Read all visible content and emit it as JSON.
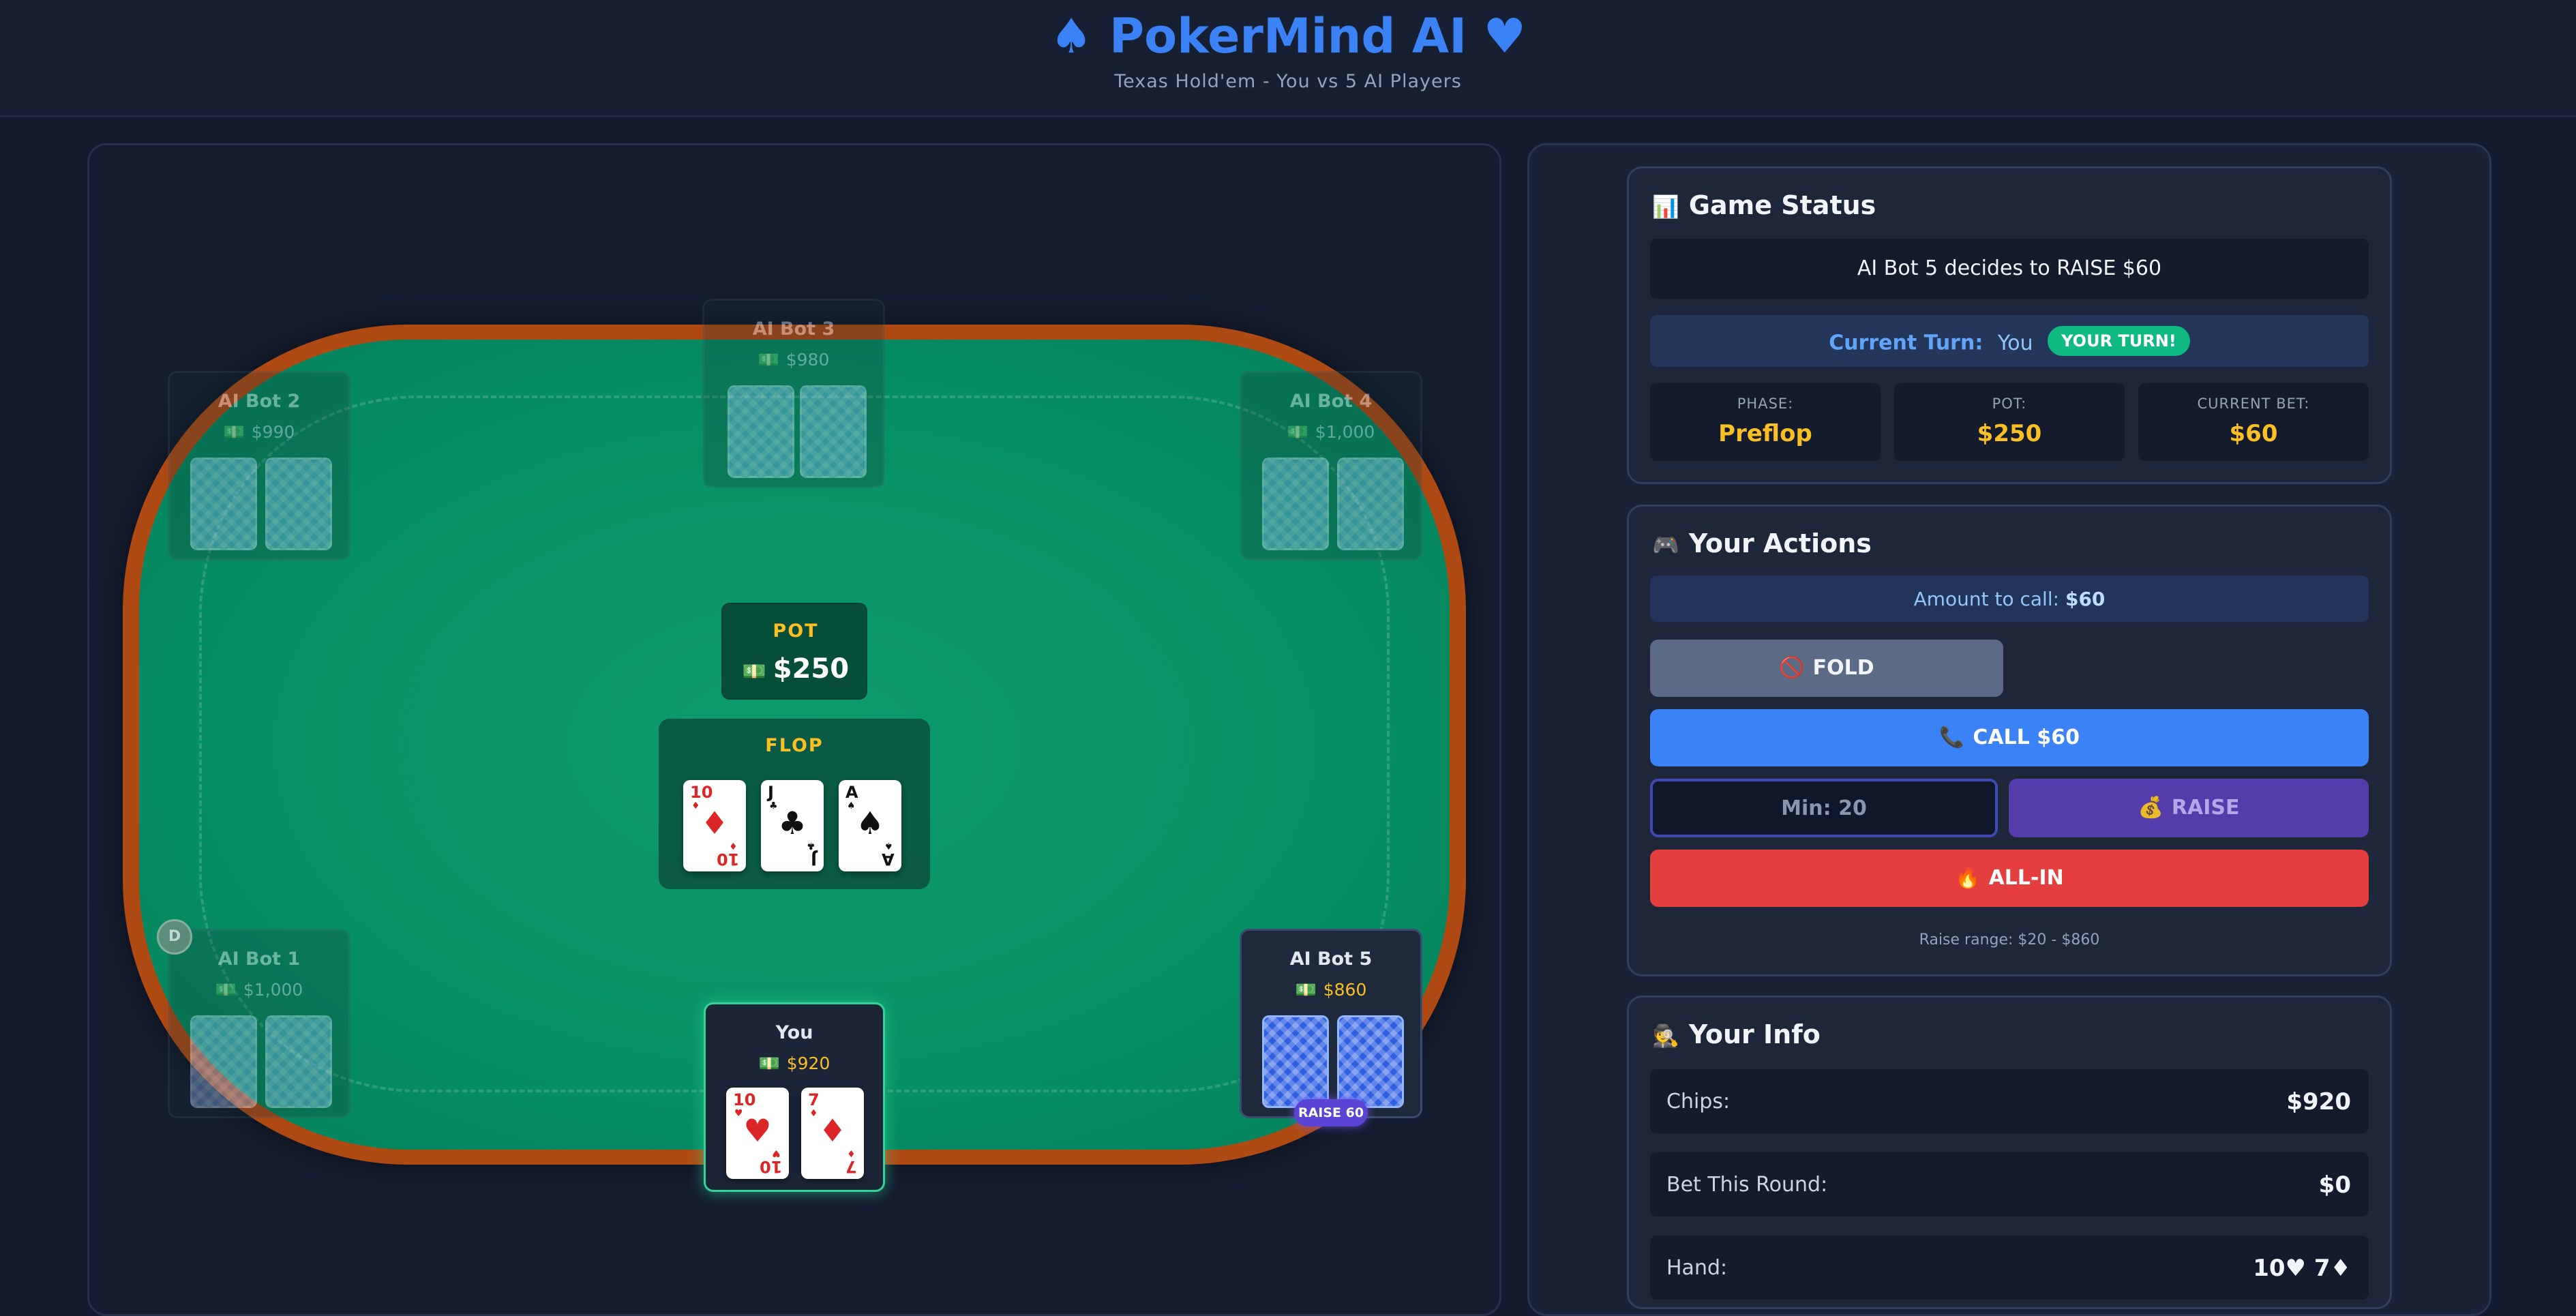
{
  "header": {
    "title": "PokerMind AI",
    "subtitle": "Texas Hold'em - You vs 5 AI Players",
    "left_icon": "spade-icon",
    "right_icon": "heart-icon"
  },
  "table": {
    "pot": {
      "label": "POT",
      "amount": "$250"
    },
    "board": {
      "label": "FLOP",
      "cards": [
        {
          "rank": "10",
          "suit": "♦",
          "color": "red"
        },
        {
          "rank": "J",
          "suit": "♣",
          "color": "black"
        },
        {
          "rank": "A",
          "suit": "♠",
          "color": "black"
        }
      ]
    },
    "dealer_button": "D",
    "seats": {
      "bot3": {
        "name": "AI Bot 3",
        "chips": "$980"
      },
      "bot2": {
        "name": "AI Bot 2",
        "chips": "$990"
      },
      "bot4": {
        "name": "AI Bot 4",
        "chips": "$1,000"
      },
      "bot1": {
        "name": "AI Bot 1",
        "chips": "$1,000"
      },
      "bot5": {
        "name": "AI Bot 5",
        "chips": "$860",
        "action": "RAISE 60"
      },
      "you": {
        "name": "You",
        "chips": "$920",
        "cards": [
          {
            "rank": "10",
            "suit": "♥",
            "color": "red"
          },
          {
            "rank": "7",
            "suit": "♦",
            "color": "red"
          }
        ]
      }
    }
  },
  "status": {
    "title": "Game Status",
    "message": "AI Bot 5 decides to RAISE $60",
    "turn_label": "Current Turn:",
    "turn_player": "You",
    "turn_badge": "YOUR TURN!",
    "stats": [
      {
        "label": "PHASE:",
        "value": "Preflop"
      },
      {
        "label": "POT:",
        "value": "$250"
      },
      {
        "label": "CURRENT BET:",
        "value": "$60"
      }
    ]
  },
  "actions": {
    "title": "Your Actions",
    "call_info_label": "Amount to call:",
    "call_info_amount": "$60",
    "fold_label": "FOLD",
    "call_label": "CALL $60",
    "raise_placeholder": "Min: 20",
    "raise_label": "RAISE",
    "allin_label": "ALL-IN",
    "raise_range": "Raise range: $20 - $860"
  },
  "info": {
    "title": "Your Info",
    "rows": [
      {
        "label": "Chips:",
        "value": "$920"
      },
      {
        "label": "Bet This Round:",
        "value": "$0"
      },
      {
        "label": "Hand:",
        "value": "10♥ 7♦"
      }
    ]
  },
  "colors": {
    "accent": "#3b82f6",
    "felt": "#079166",
    "rail": "#b04a14",
    "gold": "#fbbf24",
    "success": "#10b981",
    "danger": "#e53e3e"
  }
}
